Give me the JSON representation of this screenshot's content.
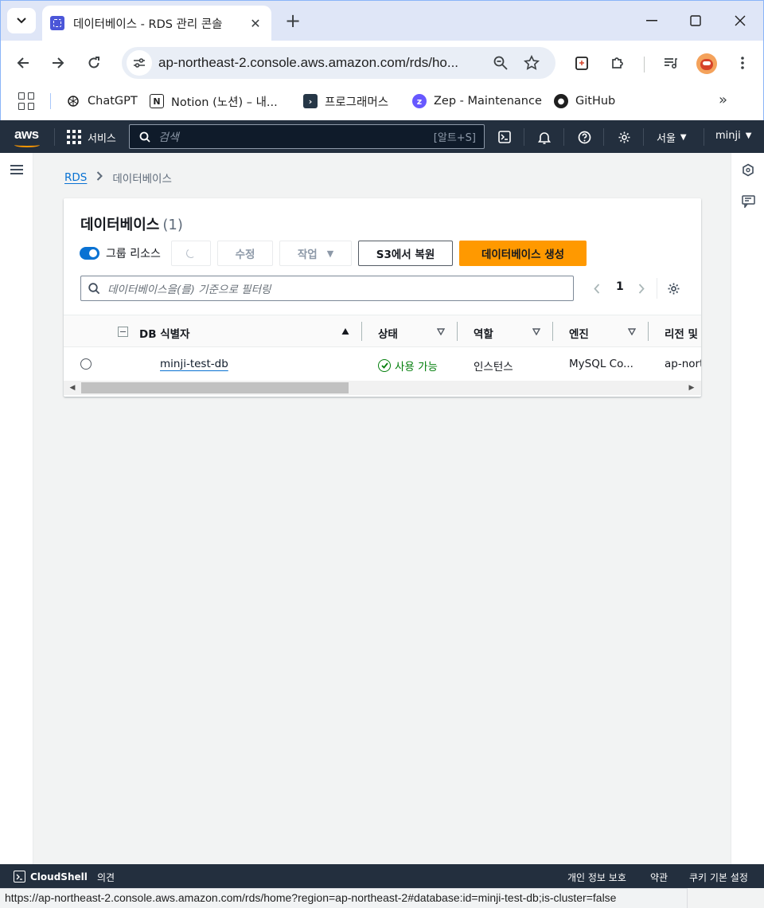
{
  "browser": {
    "tab_title": "데이터베이스 - RDS 관리 콘솔",
    "url": "ap-northeast-2.console.aws.amazon.com/rds/ho...",
    "bookmarks": [
      {
        "label": "ChatGPT",
        "icon": "chatgpt-icon"
      },
      {
        "label": "Notion (노션) – 내...",
        "icon": "notion-icon"
      },
      {
        "label": "프로그래머스",
        "icon": "programmers-icon"
      },
      {
        "label": "Zep - Maintenance",
        "icon": "zep-icon"
      },
      {
        "label": "GitHub",
        "icon": "github-icon"
      }
    ],
    "status_url": "https://ap-northeast-2.console.aws.amazon.com/rds/home?region=ap-northeast-2#database:id=minji-test-db;is-cluster=false"
  },
  "aws_nav": {
    "logo": "aws",
    "services_label": "서비스",
    "search_placeholder": "검색",
    "search_shortcut": "[알트+S]",
    "region": "서울",
    "user": "minji"
  },
  "breadcrumb": {
    "root": "RDS",
    "current": "데이터베이스"
  },
  "panel": {
    "title": "데이터베이스",
    "count": "(1)",
    "group_toggle_label": "그룹 리소스",
    "group_toggle_on": true,
    "modify_label": "수정",
    "actions_label": "작업",
    "restore_label": "S3에서 복원",
    "create_label": "데이터베이스 생성",
    "filter_placeholder": "데이터베이스을(를) 기준으로 필터링",
    "page": "1"
  },
  "table": {
    "columns": [
      "DB 식별자",
      "상태",
      "역할",
      "엔진",
      "리전 및"
    ],
    "rows": [
      {
        "identifier": "minji-test-db",
        "status": "사용 가능",
        "role": "인스턴스",
        "engine": "MySQL Co...",
        "region": "ap-nort"
      }
    ]
  },
  "footer": {
    "cloudshell": "CloudShell",
    "feedback": "의견",
    "privacy": "개인 정보 보호",
    "terms": "약관",
    "cookies": "쿠키 기본 설정"
  },
  "colors": {
    "aws_nav_bg": "#232f3e",
    "primary_button": "#ff9900",
    "link": "#0972d3",
    "status_ok": "#037f0c"
  }
}
